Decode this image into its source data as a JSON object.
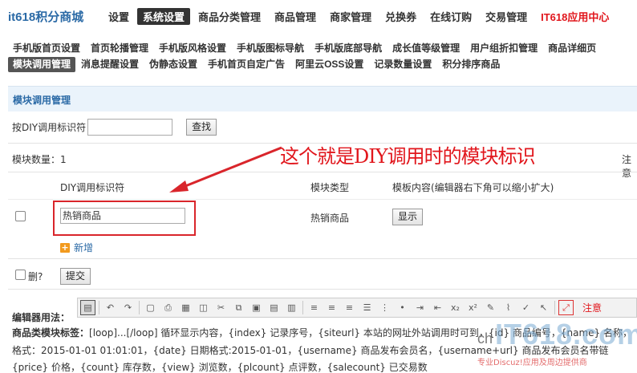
{
  "brand": "it618积分商城",
  "top_nav": [
    {
      "label": "设置",
      "active": false,
      "red": false
    },
    {
      "label": "系统设置",
      "active": true,
      "red": false
    },
    {
      "label": "商品分类管理",
      "active": false,
      "red": false
    },
    {
      "label": "商品管理",
      "active": false,
      "red": false
    },
    {
      "label": "商家管理",
      "active": false,
      "red": false
    },
    {
      "label": "兑换券",
      "active": false,
      "red": false
    },
    {
      "label": "在线订购",
      "active": false,
      "red": false
    },
    {
      "label": "交易管理",
      "active": false,
      "red": false
    },
    {
      "label": "IT618应用中心",
      "active": false,
      "red": true
    }
  ],
  "sub_nav_row1": [
    "手机版首页设置",
    "首页轮播管理",
    "手机版风格设置",
    "手机版图标导航",
    "手机版底部导航",
    "成长值等级管理",
    "用户组折扣管理",
    "商品详细页"
  ],
  "sub_nav_row2": [
    {
      "label": "模块调用管理",
      "active": true
    },
    {
      "label": "消息提醒设置",
      "active": false
    },
    {
      "label": "伪静态设置",
      "active": false
    },
    {
      "label": "手机首页自定广告",
      "active": false
    },
    {
      "label": "阿里云OSS设置",
      "active": false
    },
    {
      "label": "记录数量设置",
      "active": false
    },
    {
      "label": "积分排序商品",
      "active": false
    }
  ],
  "panel_title": "模块调用管理",
  "search": {
    "label": "按DIY调用标识符",
    "value": "",
    "button": "查找"
  },
  "module_count": "模块数量：1",
  "note_right": "注意",
  "annotation": "这个就是DIY调用时的模块标识",
  "table": {
    "headers": [
      "DIY调用标识符",
      "模块类型",
      "模板内容(编辑器右下角可以缩小扩大)"
    ],
    "rows": [
      {
        "identifier": "热销商品",
        "type": "热销商品",
        "action": "显示"
      }
    ]
  },
  "add_label": "新增",
  "delete_label": "删?",
  "submit_label": "提交",
  "editor_label": "编辑器用法：",
  "editor_note": "注意",
  "help_lines": [
    {
      "bold": "商品类模块标签：",
      "text": "[loop]...[/loop] 循环显示内容，{index} 记录序号，{siteurl} 本站的网址外站调用时可到，{id} 商品编号，{name} 名称，"
    },
    {
      "bold": "",
      "text": "格式：2015-01-01 01:01:01，{date} 日期格式:2015-01-01，{username} 商品发布会员名，{username+url} 商品发布会员名带链"
    },
    {
      "bold": "",
      "text": "{price} 价格，{count} 库存数，{view} 浏览数，{plcount} 点评数，{salecount} 已交易数"
    }
  ],
  "watermark": {
    "prefix": "ch",
    "brand": "IT618",
    "suffix": ".com",
    "tagline": "专业Discuz!应用及周边提供商"
  },
  "colors": {
    "accent": "#2b6aa6",
    "highlight": "#d9252b",
    "active_nav": "#333333",
    "red_link": "#e1161c",
    "panel_bg": "#eaf3fb"
  }
}
